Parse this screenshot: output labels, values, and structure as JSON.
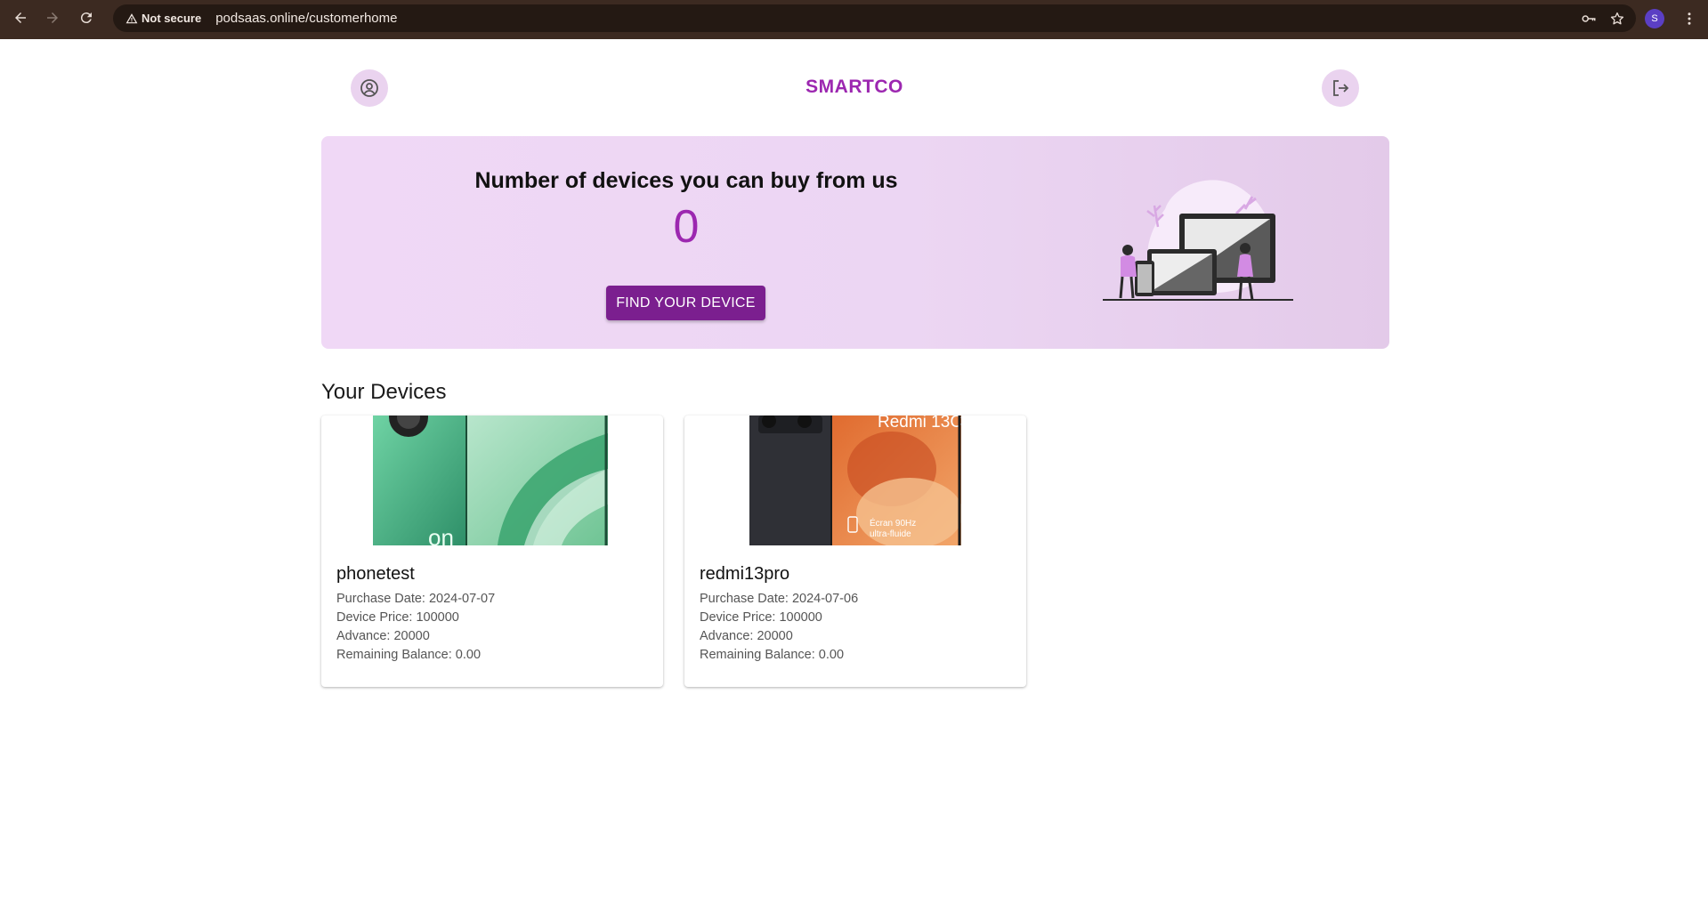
{
  "browser": {
    "security_label": "Not secure",
    "url": "podsaas.online/customerhome",
    "profile_initial": "S"
  },
  "header": {
    "brand": "SMARTCO"
  },
  "hero": {
    "title": "Number of devices you can buy from us",
    "count": "0",
    "button_label": "FIND YOUR DEVICE"
  },
  "devices": {
    "section_title": "Your Devices",
    "items": [
      {
        "name": "phonetest",
        "purchase_date": "Purchase Date: 2024-07-07",
        "price": "Device Price: 100000",
        "advance": "Advance: 20000",
        "balance": "Remaining Balance: 0.00"
      },
      {
        "name": "redmi13pro",
        "purchase_date": "Purchase Date: 2024-07-06",
        "price": "Device Price: 100000",
        "advance": "Advance: 20000",
        "balance": "Remaining Balance: 0.00",
        "image_text_model": "Redmi 13C",
        "image_text_feature": "Écran 90Hz",
        "image_text_feature2": "ultra-fluide"
      }
    ]
  },
  "colors": {
    "accent": "#9c27b0",
    "button": "#7b1f8f",
    "chrome": "#3c2a21"
  }
}
